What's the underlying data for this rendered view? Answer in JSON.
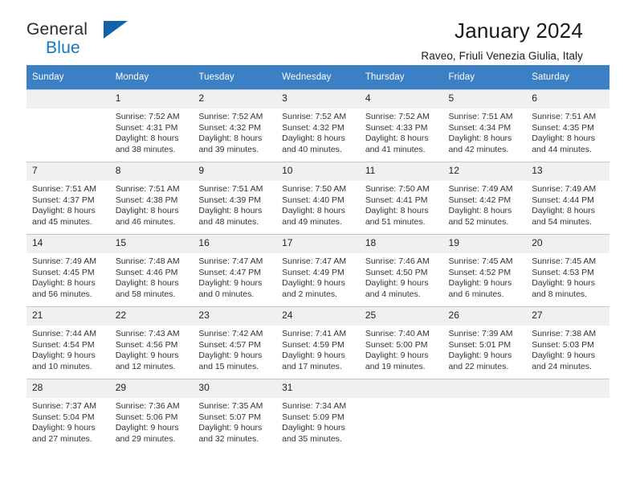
{
  "logo": {
    "word_one": "General",
    "word_two": "Blue",
    "triangle_icon": "triangle-icon"
  },
  "header": {
    "title": "January 2024",
    "subtitle": "Raveo, Friuli Venezia Giulia, Italy"
  },
  "calendar": {
    "weekday_headers": [
      "Sunday",
      "Monday",
      "Tuesday",
      "Wednesday",
      "Thursday",
      "Friday",
      "Saturday"
    ],
    "colors": {
      "header_background": "#3b7fc4",
      "header_text": "#ffffff",
      "daynum_background": "#f0f0f0",
      "cell_background": "#ffffff",
      "grid_line": "#b9c9da",
      "logo_blue": "#1278be",
      "logo_triangle": "#1263a8"
    },
    "weeks": [
      [
        {
          "day": "",
          "sunrise": "",
          "sunset": "",
          "daylight_line1": "",
          "daylight_line2": "",
          "empty": true
        },
        {
          "day": "1",
          "sunrise": "Sunrise: 7:52 AM",
          "sunset": "Sunset: 4:31 PM",
          "daylight_line1": "Daylight: 8 hours",
          "daylight_line2": "and 38 minutes."
        },
        {
          "day": "2",
          "sunrise": "Sunrise: 7:52 AM",
          "sunset": "Sunset: 4:32 PM",
          "daylight_line1": "Daylight: 8 hours",
          "daylight_line2": "and 39 minutes."
        },
        {
          "day": "3",
          "sunrise": "Sunrise: 7:52 AM",
          "sunset": "Sunset: 4:32 PM",
          "daylight_line1": "Daylight: 8 hours",
          "daylight_line2": "and 40 minutes."
        },
        {
          "day": "4",
          "sunrise": "Sunrise: 7:52 AM",
          "sunset": "Sunset: 4:33 PM",
          "daylight_line1": "Daylight: 8 hours",
          "daylight_line2": "and 41 minutes."
        },
        {
          "day": "5",
          "sunrise": "Sunrise: 7:51 AM",
          "sunset": "Sunset: 4:34 PM",
          "daylight_line1": "Daylight: 8 hours",
          "daylight_line2": "and 42 minutes."
        },
        {
          "day": "6",
          "sunrise": "Sunrise: 7:51 AM",
          "sunset": "Sunset: 4:35 PM",
          "daylight_line1": "Daylight: 8 hours",
          "daylight_line2": "and 44 minutes."
        }
      ],
      [
        {
          "day": "7",
          "sunrise": "Sunrise: 7:51 AM",
          "sunset": "Sunset: 4:37 PM",
          "daylight_line1": "Daylight: 8 hours",
          "daylight_line2": "and 45 minutes."
        },
        {
          "day": "8",
          "sunrise": "Sunrise: 7:51 AM",
          "sunset": "Sunset: 4:38 PM",
          "daylight_line1": "Daylight: 8 hours",
          "daylight_line2": "and 46 minutes."
        },
        {
          "day": "9",
          "sunrise": "Sunrise: 7:51 AM",
          "sunset": "Sunset: 4:39 PM",
          "daylight_line1": "Daylight: 8 hours",
          "daylight_line2": "and 48 minutes."
        },
        {
          "day": "10",
          "sunrise": "Sunrise: 7:50 AM",
          "sunset": "Sunset: 4:40 PM",
          "daylight_line1": "Daylight: 8 hours",
          "daylight_line2": "and 49 minutes."
        },
        {
          "day": "11",
          "sunrise": "Sunrise: 7:50 AM",
          "sunset": "Sunset: 4:41 PM",
          "daylight_line1": "Daylight: 8 hours",
          "daylight_line2": "and 51 minutes."
        },
        {
          "day": "12",
          "sunrise": "Sunrise: 7:49 AM",
          "sunset": "Sunset: 4:42 PM",
          "daylight_line1": "Daylight: 8 hours",
          "daylight_line2": "and 52 minutes."
        },
        {
          "day": "13",
          "sunrise": "Sunrise: 7:49 AM",
          "sunset": "Sunset: 4:44 PM",
          "daylight_line1": "Daylight: 8 hours",
          "daylight_line2": "and 54 minutes."
        }
      ],
      [
        {
          "day": "14",
          "sunrise": "Sunrise: 7:49 AM",
          "sunset": "Sunset: 4:45 PM",
          "daylight_line1": "Daylight: 8 hours",
          "daylight_line2": "and 56 minutes."
        },
        {
          "day": "15",
          "sunrise": "Sunrise: 7:48 AM",
          "sunset": "Sunset: 4:46 PM",
          "daylight_line1": "Daylight: 8 hours",
          "daylight_line2": "and 58 minutes."
        },
        {
          "day": "16",
          "sunrise": "Sunrise: 7:47 AM",
          "sunset": "Sunset: 4:47 PM",
          "daylight_line1": "Daylight: 9 hours",
          "daylight_line2": "and 0 minutes."
        },
        {
          "day": "17",
          "sunrise": "Sunrise: 7:47 AM",
          "sunset": "Sunset: 4:49 PM",
          "daylight_line1": "Daylight: 9 hours",
          "daylight_line2": "and 2 minutes."
        },
        {
          "day": "18",
          "sunrise": "Sunrise: 7:46 AM",
          "sunset": "Sunset: 4:50 PM",
          "daylight_line1": "Daylight: 9 hours",
          "daylight_line2": "and 4 minutes."
        },
        {
          "day": "19",
          "sunrise": "Sunrise: 7:45 AM",
          "sunset": "Sunset: 4:52 PM",
          "daylight_line1": "Daylight: 9 hours",
          "daylight_line2": "and 6 minutes."
        },
        {
          "day": "20",
          "sunrise": "Sunrise: 7:45 AM",
          "sunset": "Sunset: 4:53 PM",
          "daylight_line1": "Daylight: 9 hours",
          "daylight_line2": "and 8 minutes."
        }
      ],
      [
        {
          "day": "21",
          "sunrise": "Sunrise: 7:44 AM",
          "sunset": "Sunset: 4:54 PM",
          "daylight_line1": "Daylight: 9 hours",
          "daylight_line2": "and 10 minutes."
        },
        {
          "day": "22",
          "sunrise": "Sunrise: 7:43 AM",
          "sunset": "Sunset: 4:56 PM",
          "daylight_line1": "Daylight: 9 hours",
          "daylight_line2": "and 12 minutes."
        },
        {
          "day": "23",
          "sunrise": "Sunrise: 7:42 AM",
          "sunset": "Sunset: 4:57 PM",
          "daylight_line1": "Daylight: 9 hours",
          "daylight_line2": "and 15 minutes."
        },
        {
          "day": "24",
          "sunrise": "Sunrise: 7:41 AM",
          "sunset": "Sunset: 4:59 PM",
          "daylight_line1": "Daylight: 9 hours",
          "daylight_line2": "and 17 minutes."
        },
        {
          "day": "25",
          "sunrise": "Sunrise: 7:40 AM",
          "sunset": "Sunset: 5:00 PM",
          "daylight_line1": "Daylight: 9 hours",
          "daylight_line2": "and 19 minutes."
        },
        {
          "day": "26",
          "sunrise": "Sunrise: 7:39 AM",
          "sunset": "Sunset: 5:01 PM",
          "daylight_line1": "Daylight: 9 hours",
          "daylight_line2": "and 22 minutes."
        },
        {
          "day": "27",
          "sunrise": "Sunrise: 7:38 AM",
          "sunset": "Sunset: 5:03 PM",
          "daylight_line1": "Daylight: 9 hours",
          "daylight_line2": "and 24 minutes."
        }
      ],
      [
        {
          "day": "28",
          "sunrise": "Sunrise: 7:37 AM",
          "sunset": "Sunset: 5:04 PM",
          "daylight_line1": "Daylight: 9 hours",
          "daylight_line2": "and 27 minutes."
        },
        {
          "day": "29",
          "sunrise": "Sunrise: 7:36 AM",
          "sunset": "Sunset: 5:06 PM",
          "daylight_line1": "Daylight: 9 hours",
          "daylight_line2": "and 29 minutes."
        },
        {
          "day": "30",
          "sunrise": "Sunrise: 7:35 AM",
          "sunset": "Sunset: 5:07 PM",
          "daylight_line1": "Daylight: 9 hours",
          "daylight_line2": "and 32 minutes."
        },
        {
          "day": "31",
          "sunrise": "Sunrise: 7:34 AM",
          "sunset": "Sunset: 5:09 PM",
          "daylight_line1": "Daylight: 9 hours",
          "daylight_line2": "and 35 minutes."
        },
        {
          "day": "",
          "sunrise": "",
          "sunset": "",
          "daylight_line1": "",
          "daylight_line2": "",
          "empty": true
        },
        {
          "day": "",
          "sunrise": "",
          "sunset": "",
          "daylight_line1": "",
          "daylight_line2": "",
          "empty": true
        },
        {
          "day": "",
          "sunrise": "",
          "sunset": "",
          "daylight_line1": "",
          "daylight_line2": "",
          "empty": true
        }
      ]
    ]
  }
}
